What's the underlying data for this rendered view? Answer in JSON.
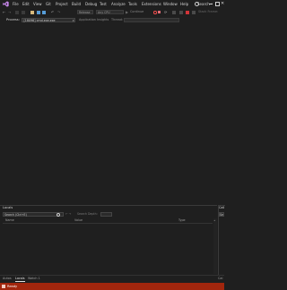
{
  "menu": {
    "items": [
      "File",
      "Edit",
      "View",
      "Git",
      "Project",
      "Build",
      "Debug",
      "Test",
      "Analyze",
      "Tools",
      "Extensions",
      "Window",
      "Help"
    ],
    "search_label": "Search •"
  },
  "toolbar": {
    "config_box": "Release",
    "platform_box": "Any CPU",
    "continue_label": "Continue",
    "app_insights_label": "Application Insights",
    "thread_label": "Thread:",
    "stack_frame_label": "Stack Frame:"
  },
  "process": {
    "label": "Process:",
    "value": "[18096] cmd.exe.exe"
  },
  "locals": {
    "title": "Locals",
    "search_placeholder": "Search (Ctrl+E)",
    "nav": "←  →",
    "search_depth_label": "Search Depth:",
    "columns": {
      "name": "Name",
      "value": "Value",
      "type": "Type"
    }
  },
  "right_panel": {
    "title": "Call",
    "search": "Sea"
  },
  "bottom_tabs": [
    "Autos",
    "Locals",
    "Watch 1"
  ],
  "right_tab": "Cal",
  "status": {
    "text": "Ready"
  },
  "colors": {
    "status_bar": "#a1260d",
    "background": "#1f1f1f"
  }
}
